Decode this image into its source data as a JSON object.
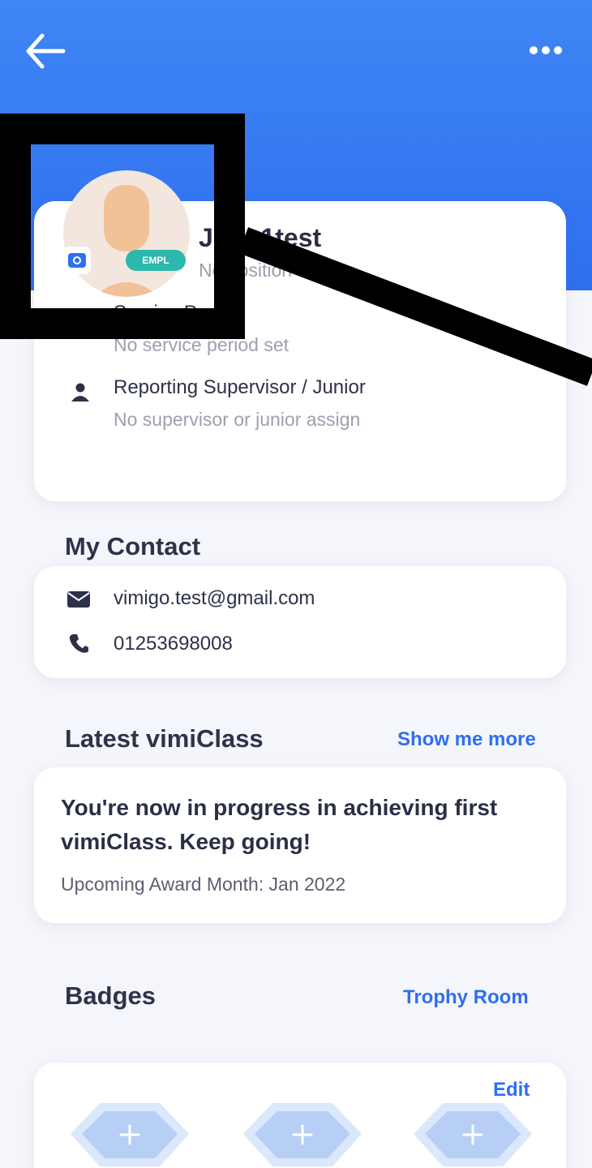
{
  "header": {
    "back_icon": "arrow-left-icon",
    "more_icon": "ellipsis-icon",
    "color": "#3377f2"
  },
  "profile": {
    "name": "John1test",
    "position": "No position set",
    "avatar_badge": "EMPL",
    "camera_icon": "camera-icon",
    "service_period": {
      "title": "Service Period",
      "value": "No service period set",
      "icon": "calendar-icon"
    },
    "supervisor": {
      "title": "Reporting Supervisor / Junior",
      "value": "No supervisor or junior assign",
      "icon": "person-icon"
    }
  },
  "contact": {
    "title": "My Contact",
    "email": "vimigo.test@gmail.com",
    "phone": "01253698008",
    "email_icon": "mail-icon",
    "phone_icon": "phone-icon"
  },
  "vimiclass": {
    "title": "Latest vimiClass",
    "link": "Show me more",
    "message": "You're now in progress in achieving first vimiClass. Keep going!",
    "upcoming": "Upcoming Award Month: Jan 2022"
  },
  "badges": {
    "title": "Badges",
    "link": "Trophy Room",
    "edit": "Edit",
    "slots": [
      {
        "icon": "add-badge-icon"
      },
      {
        "icon": "add-badge-icon"
      },
      {
        "icon": "add-badge-icon"
      }
    ]
  },
  "colors": {
    "primary": "#2f6ff0",
    "text_dark": "#2d3148",
    "text_muted": "#9da0ae",
    "empl_badge": "#2cb8ac"
  }
}
